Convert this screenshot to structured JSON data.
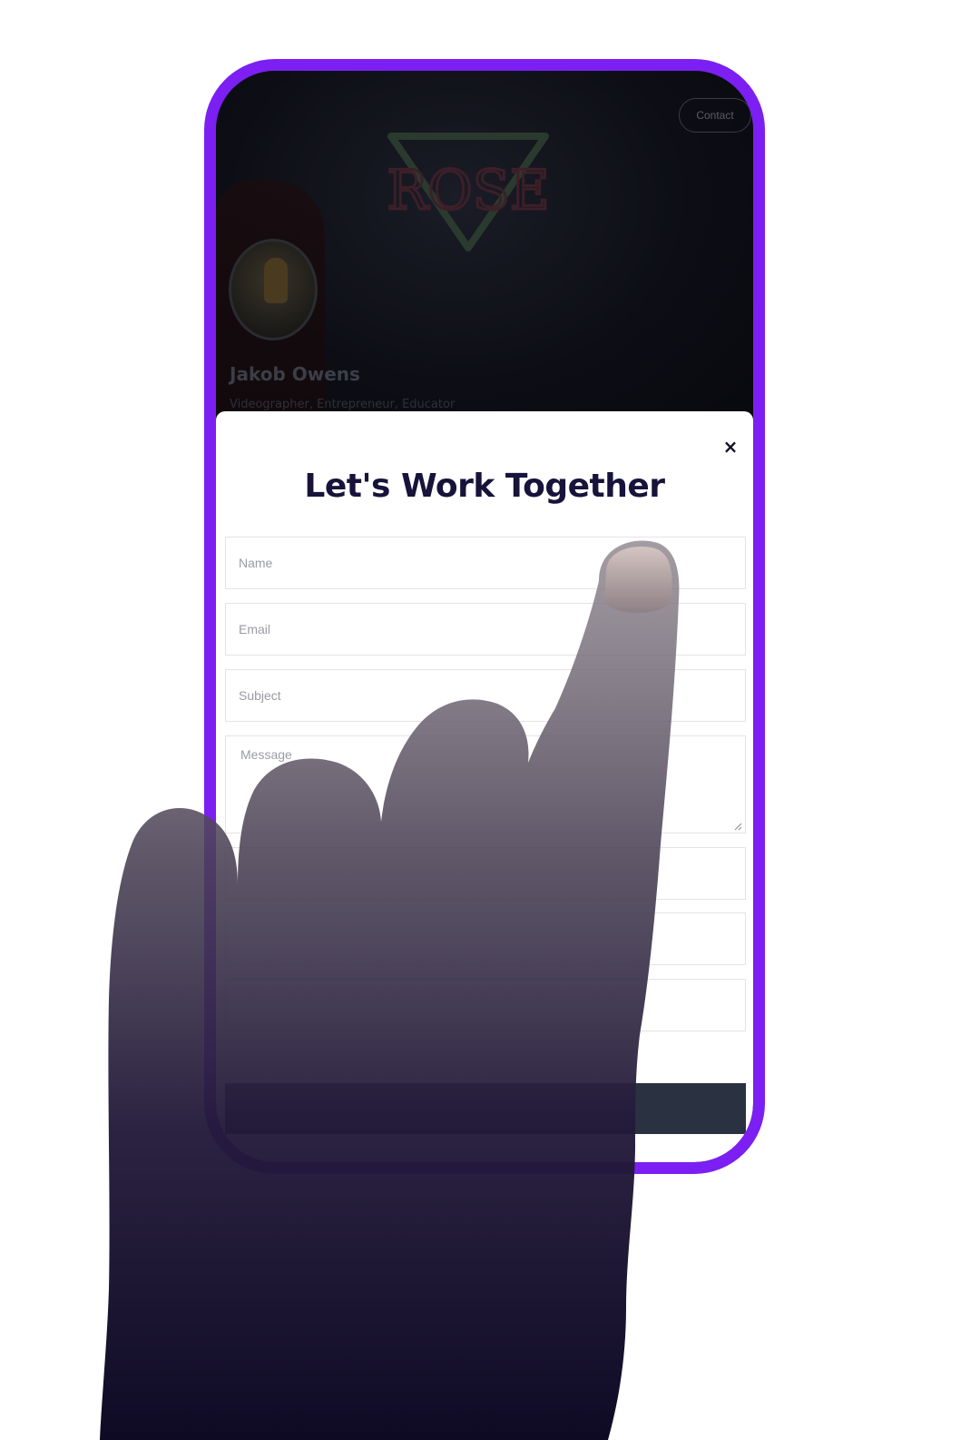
{
  "header": {
    "contact_label": "Contact"
  },
  "hero": {
    "logo_text": "ROSE"
  },
  "profile": {
    "name": "Jakob Owens",
    "tagline": "Videographer, Entrepreneur, Educator"
  },
  "modal": {
    "title": "Let's Work Together",
    "close_label": "×",
    "fields": {
      "name_placeholder": "Name",
      "email_placeholder": "Email",
      "subject_placeholder": "Subject",
      "message_placeholder": "Message"
    },
    "submit_label": ""
  },
  "colors": {
    "frame": "#7b1ff2",
    "title": "#17133a",
    "submit": "#2a3140"
  },
  "icons": {
    "close": "close-icon",
    "resize": "resize-grip-icon"
  }
}
